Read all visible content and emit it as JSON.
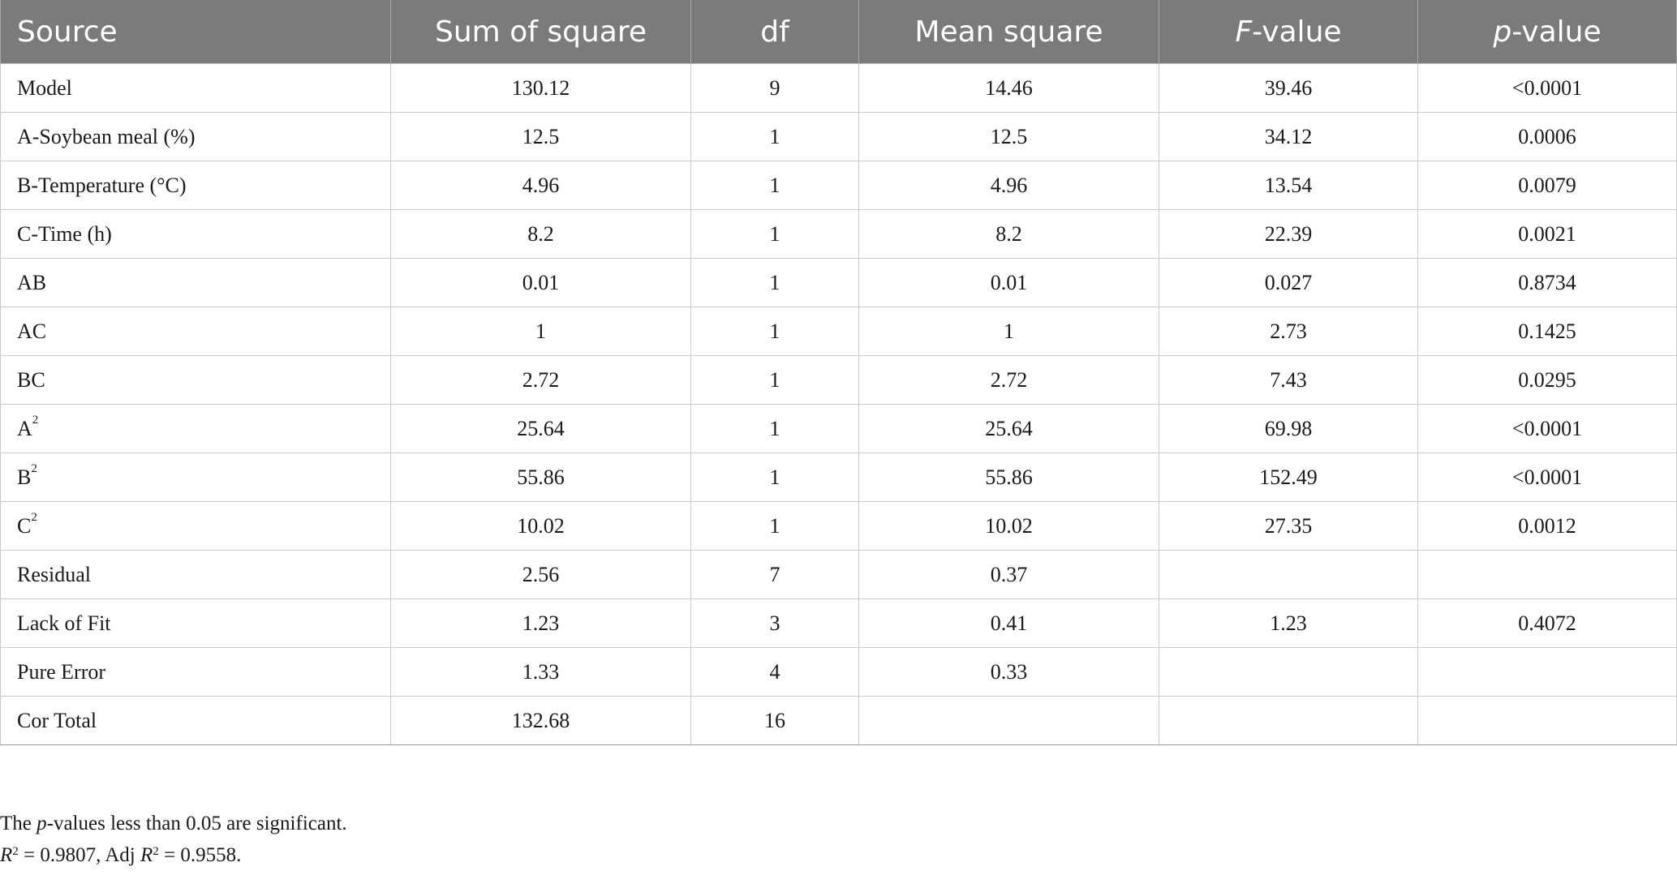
{
  "table": {
    "columns": [
      {
        "pre": "Source",
        "ital": "",
        "post": ""
      },
      {
        "pre": "Sum of square",
        "ital": "",
        "post": ""
      },
      {
        "pre": "df",
        "ital": "",
        "post": ""
      },
      {
        "pre": "Mean square",
        "ital": "",
        "post": ""
      },
      {
        "pre": "",
        "ital": "F",
        "post": "-value"
      },
      {
        "pre": "",
        "ital": "p",
        "post": "-value"
      }
    ],
    "rows": [
      {
        "source": "Model",
        "sup": "",
        "ss": "130.12",
        "df": "9",
        "ms": "14.46",
        "f": "39.46",
        "p": "<0.0001"
      },
      {
        "source": "A-Soybean meal (%)",
        "sup": "",
        "ss": "12.5",
        "df": "1",
        "ms": "12.5",
        "f": "34.12",
        "p": "0.0006"
      },
      {
        "source": "B-Temperature (°C)",
        "sup": "",
        "ss": "4.96",
        "df": "1",
        "ms": "4.96",
        "f": "13.54",
        "p": "0.0079"
      },
      {
        "source": "C-Time (h)",
        "sup": "",
        "ss": "8.2",
        "df": "1",
        "ms": "8.2",
        "f": "22.39",
        "p": "0.0021"
      },
      {
        "source": "AB",
        "sup": "",
        "ss": "0.01",
        "df": "1",
        "ms": "0.01",
        "f": "0.027",
        "p": "0.8734"
      },
      {
        "source": "AC",
        "sup": "",
        "ss": "1",
        "df": "1",
        "ms": "1",
        "f": "2.73",
        "p": "0.1425"
      },
      {
        "source": "BC",
        "sup": "",
        "ss": "2.72",
        "df": "1",
        "ms": "2.72",
        "f": "7.43",
        "p": "0.0295"
      },
      {
        "source": "A",
        "sup": "2",
        "ss": "25.64",
        "df": "1",
        "ms": "25.64",
        "f": "69.98",
        "p": "<0.0001"
      },
      {
        "source": "B",
        "sup": "2",
        "ss": "55.86",
        "df": "1",
        "ms": "55.86",
        "f": "152.49",
        "p": "<0.0001"
      },
      {
        "source": "C",
        "sup": "2",
        "ss": "10.02",
        "df": "1",
        "ms": "10.02",
        "f": "27.35",
        "p": "0.0012"
      },
      {
        "source": "Residual",
        "sup": "",
        "ss": "2.56",
        "df": "7",
        "ms": "0.37",
        "f": "",
        "p": ""
      },
      {
        "source": "Lack of Fit",
        "sup": "",
        "ss": "1.23",
        "df": "3",
        "ms": "0.41",
        "f": "1.23",
        "p": "0.4072"
      },
      {
        "source": "Pure Error",
        "sup": "",
        "ss": "1.33",
        "df": "4",
        "ms": "0.33",
        "f": "",
        "p": ""
      },
      {
        "source": "Cor Total",
        "sup": "",
        "ss": "132.68",
        "df": "16",
        "ms": "",
        "f": "",
        "p": ""
      }
    ]
  },
  "footnotes": {
    "line1": {
      "pre": "The ",
      "ital": "p",
      "post": "-values less than 0.05 are significant."
    },
    "line2": {
      "r_ital": "R",
      "r_sup": "2",
      "r_val": " = 0.9807, Adj ",
      "adj_ital": "R",
      "adj_sup": "2",
      "adj_val": " = 0.9558."
    }
  },
  "colors": {
    "header_bg": "#7a7b7a",
    "header_text": "#ffffff",
    "grid": "#c9c9c9"
  }
}
